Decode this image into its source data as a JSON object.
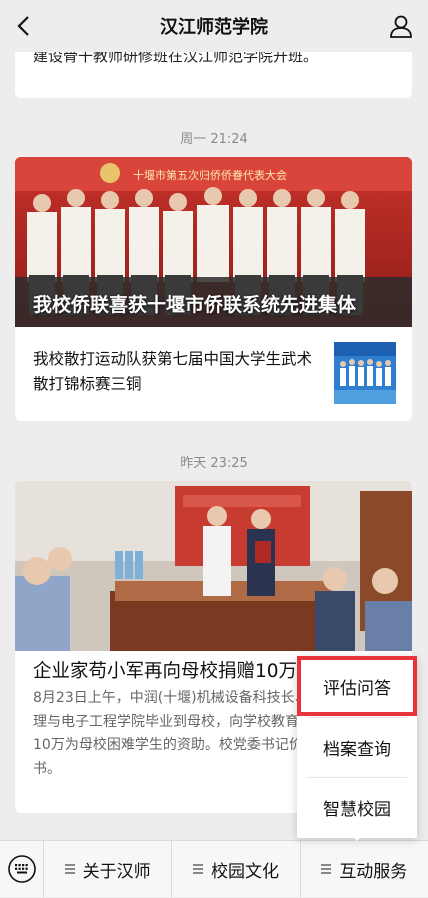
{
  "header": {
    "title": "汉江师范学院"
  },
  "top_card": {
    "text": "建设骨干教师研修班在汉江师范学院开班。"
  },
  "group1": {
    "time": "周一 21:24",
    "hero_caption": "我校侨联喜获十堰市侨联系统先进集体",
    "banner_text": "十堰市第五次归侨侨眷代表大会",
    "sub_title": "我校散打运动队获第七届中国大学生武术散打锦标赛三铜"
  },
  "group2": {
    "time": "昨天 23:25",
    "title": "企业家苟小军再向母校捐赠10万",
    "desc": "8月23日上午，中润(十堰)机械设备科技长、我校2005届物理与电子工程学院毕业到母校，向学校教育发展基金会捐款10万为母校困难学生的资助。校党委书记价军颁发捐赠证书。"
  },
  "bottom_menu": {
    "items": [
      {
        "label": "关于汉师"
      },
      {
        "label": "校园文化"
      },
      {
        "label": "互动服务"
      }
    ]
  },
  "popup_menu": {
    "items": [
      {
        "label": "评估问答"
      },
      {
        "label": "档案查询"
      },
      {
        "label": "智慧校园"
      }
    ]
  },
  "colors": {
    "highlight": "#e8333a",
    "background": "#ededed"
  }
}
